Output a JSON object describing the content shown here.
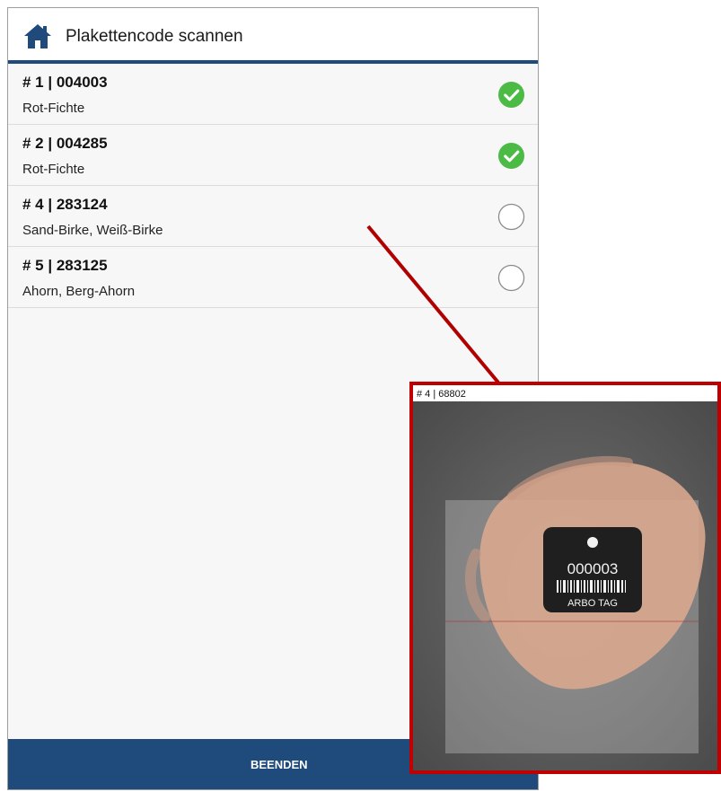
{
  "appbar": {
    "title": "Plakettencode scannen",
    "icon": "home-icon"
  },
  "rows": [
    {
      "title": "# 1 | 004003",
      "subtitle": "Rot-Fichte",
      "status": "checked"
    },
    {
      "title": "# 2 | 004285",
      "subtitle": "Rot-Fichte",
      "status": "checked"
    },
    {
      "title": "# 4 | 283124",
      "subtitle": "Sand-Birke, Weiß-Birke",
      "status": "unchecked"
    },
    {
      "title": "# 5 | 283125",
      "subtitle": "Ahorn, Berg-Ahorn",
      "status": "unchecked"
    }
  ],
  "footer": {
    "button_label": "BEENDEN"
  },
  "inset": {
    "caption": "# 4 | 68802",
    "tag_code": "000003",
    "tag_brand": "ARBO TAG"
  },
  "colors": {
    "primary": "#1e4a7c",
    "check_green": "#4cbb45",
    "highlight_red": "#c00000",
    "background": "#f7f7f7"
  }
}
